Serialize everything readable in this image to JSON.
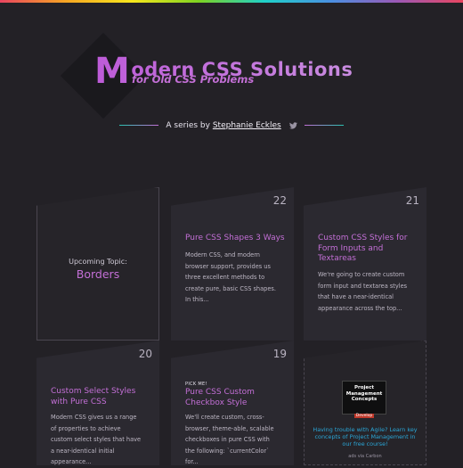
{
  "hero": {
    "title_initial": "M",
    "title_rest": "odern CSS Solutions",
    "subtitle": "for Old CSS Problems",
    "byline_prefix": "A series by",
    "author": "Stephanie Eckles"
  },
  "cards": [
    {
      "label": "Upcoming Topic:",
      "topic": "Borders"
    },
    {
      "number": "22",
      "title": "Pure CSS Shapes 3 Ways",
      "desc": "Modern CSS, and modern browser support, provides us three excellent methods to create pure, basic CSS shapes. In this..."
    },
    {
      "number": "21",
      "title": "Custom CSS Styles for Form Inputs and Textareas",
      "desc": "We're going to create custom form input and textarea styles that have a near-identical appearance across the top..."
    },
    {
      "number": "20",
      "title": "Custom Select Styles with Pure CSS",
      "desc": "Modern CSS gives us a range of properties to achieve custom select styles that have a near-identical initial appearance..."
    },
    {
      "number": "19",
      "badge": "PICK ME!",
      "title": "Pure CSS Custom Checkbox Style",
      "desc": "We'll create custom, cross-browser, theme-able, scalable checkboxes in pure CSS with the following: `currentColor` for..."
    }
  ],
  "ad": {
    "image_text": "Project Management Concepts",
    "image_badge": "Develop",
    "text": "Having trouble with Agile? Learn key concepts of Project Management in our free course!",
    "via": "ads via Carbon"
  },
  "icons": {
    "byline": "twitter-icon"
  },
  "colors": {
    "accent": "#c36fd6",
    "teal": "#2ac1b0",
    "background": "#232126",
    "card": "#2b2930",
    "link": "#2aa7d8"
  }
}
